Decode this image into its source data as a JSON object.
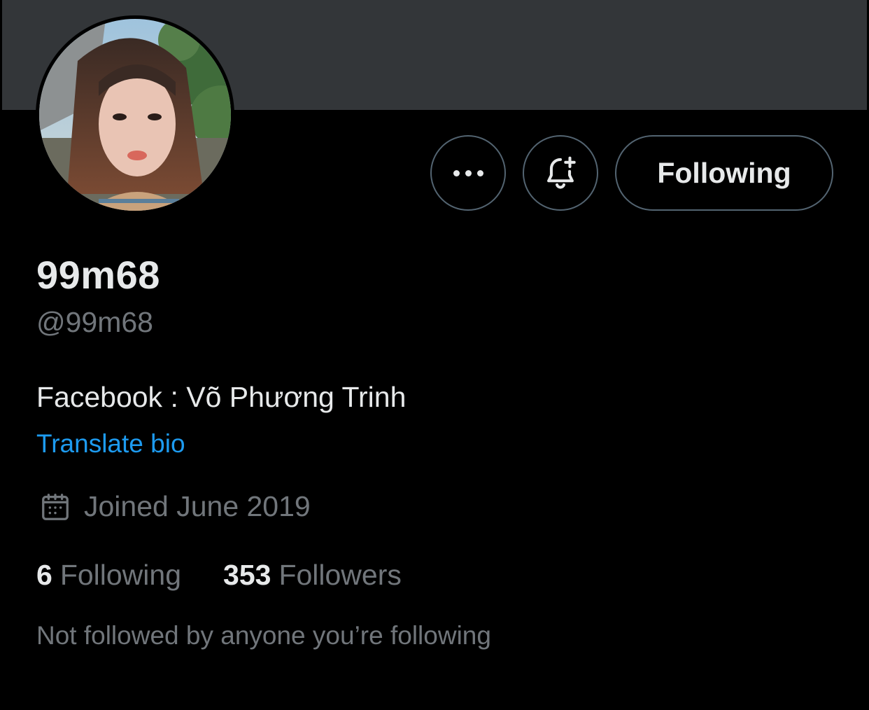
{
  "profile": {
    "display_name": "99m68",
    "handle": "@99m68",
    "bio": "Facebook : Võ Phương Trinh",
    "translate_label": "Translate bio",
    "joined": "Joined June 2019",
    "following_count": "6",
    "following_label": "Following",
    "followers_count": "353",
    "followers_label": "Followers",
    "mutuals_text": "Not followed by anyone you’re following"
  },
  "actions": {
    "more_icon": "more-horizontal-icon",
    "notify_icon": "bell-plus-icon",
    "follow_label": "Following"
  },
  "colors": {
    "background": "#000000",
    "banner": "#333639",
    "primary_text": "#e7e9ea",
    "secondary_text": "#71767b",
    "link": "#1d9bf0",
    "button_border": "#536471"
  }
}
